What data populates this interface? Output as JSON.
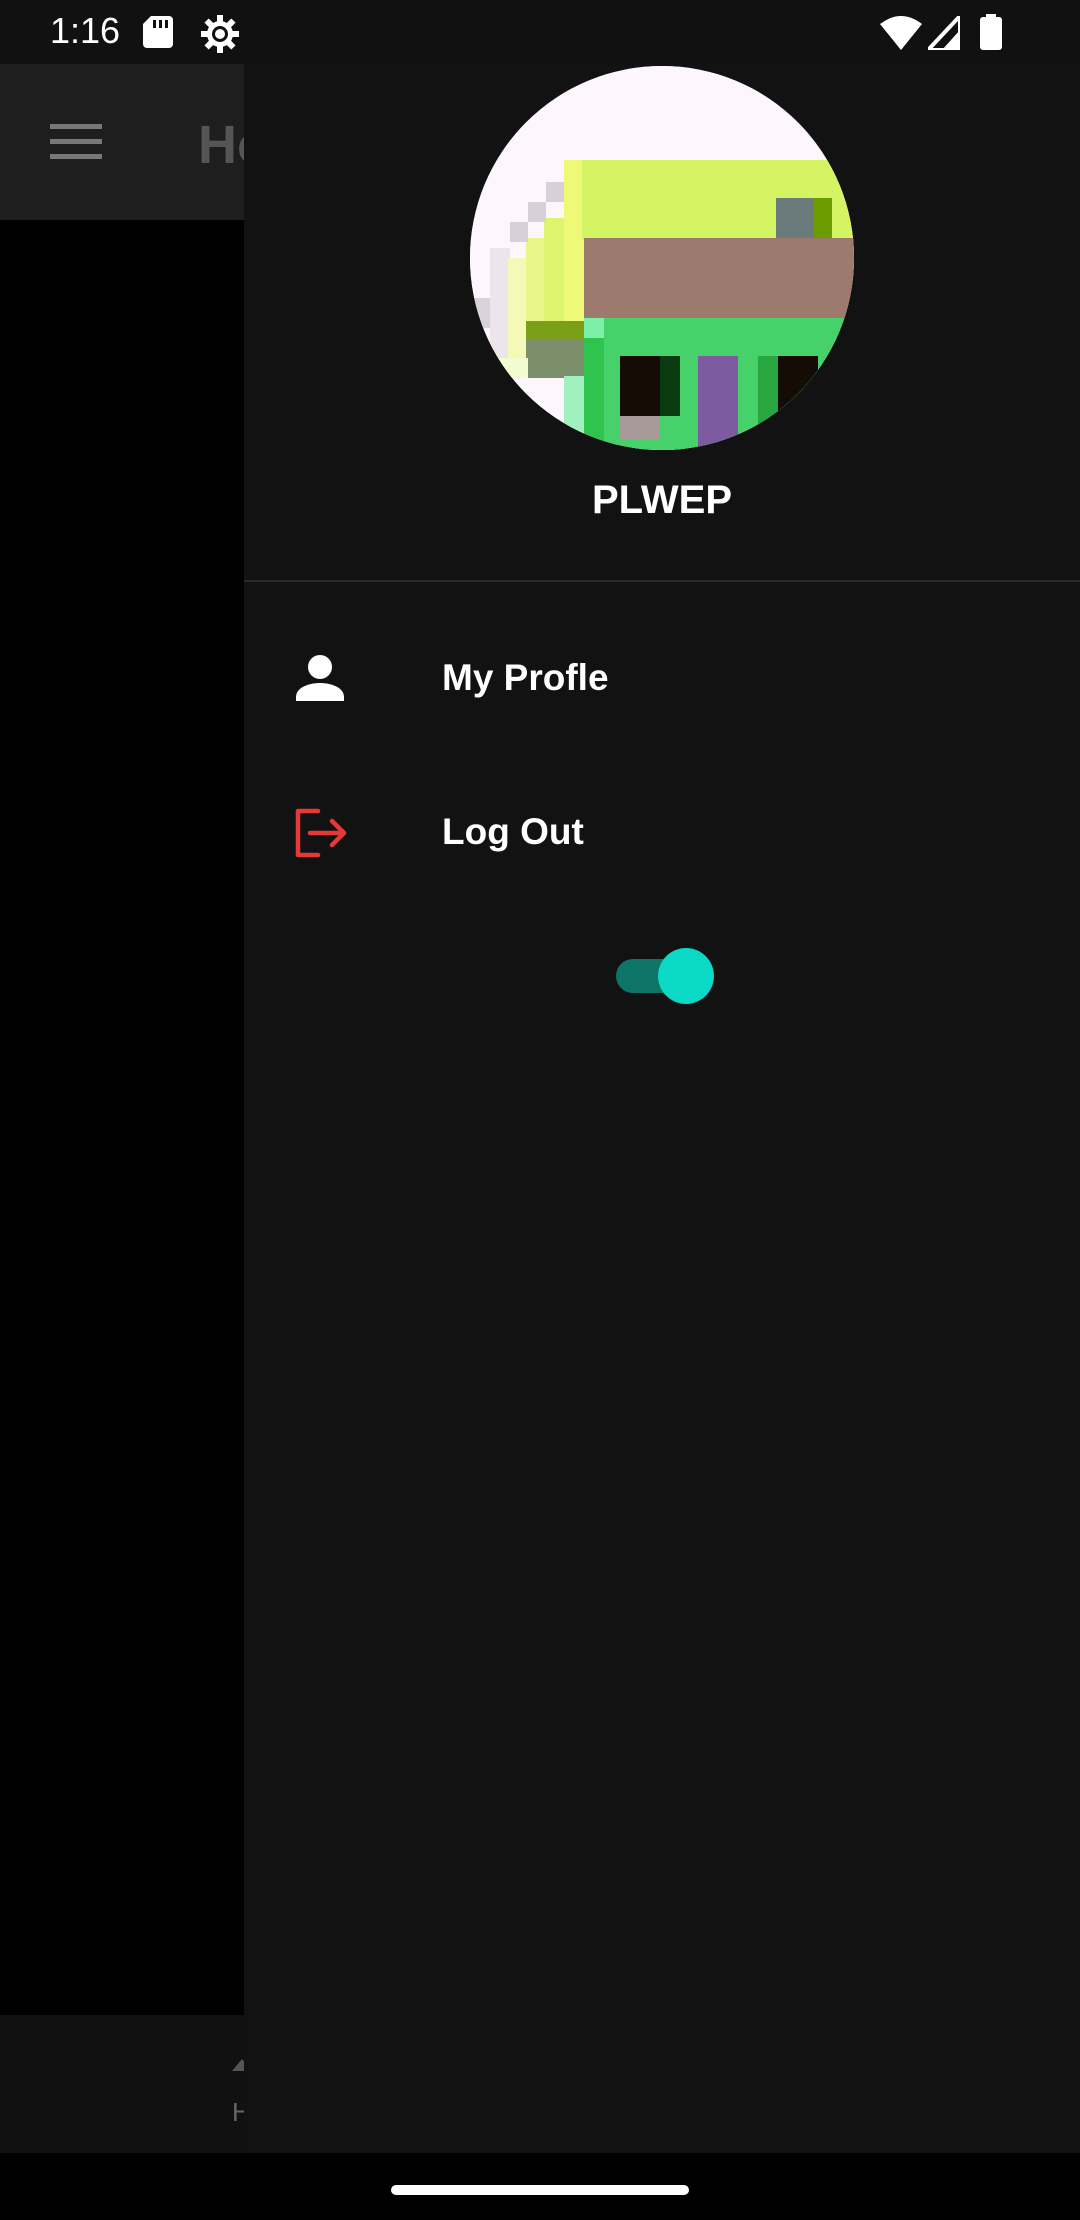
{
  "status_bar": {
    "time": "1:16",
    "icons": [
      "sd-card-icon",
      "gear-icon",
      "wifi-icon",
      "signal-icon",
      "battery-icon"
    ]
  },
  "background_app": {
    "title": "Ho",
    "menu_icon": "menu-icon",
    "bottom_nav_label": "H"
  },
  "drawer": {
    "username": "PLWEP",
    "items": [
      {
        "label": "My Profle",
        "icon": "person-icon",
        "color": "#ffffff"
      },
      {
        "label": "Log Out",
        "icon": "logout-icon",
        "color": "#e53935"
      }
    ],
    "toggle": {
      "state": "on",
      "track_color": "#0d7468",
      "thumb_color": "#0ad9c6"
    }
  },
  "colors": {
    "drawer_background": "#121212",
    "scrim": "#000000",
    "accent": "#0ad9c6"
  }
}
